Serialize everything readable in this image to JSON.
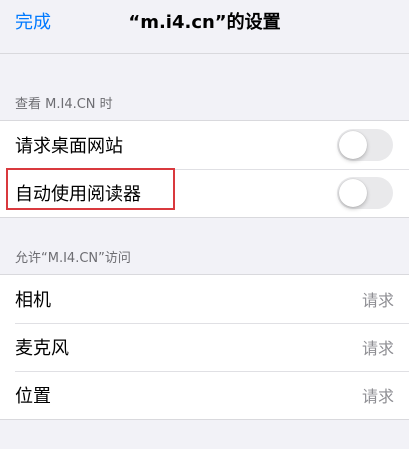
{
  "nav": {
    "done_label": "完成",
    "title": "“m.i4.cn”的设置"
  },
  "view_section": {
    "header": "查看 M.I4.CN 时",
    "rows": [
      {
        "label": "请求桌面网站",
        "toggle_on": false
      },
      {
        "label": "自动使用阅读器",
        "toggle_on": false
      }
    ]
  },
  "access_section": {
    "header": "允许“M.I4.CN”访问",
    "rows": [
      {
        "label": "相机",
        "value": "请求"
      },
      {
        "label": "麦克风",
        "value": "请求"
      },
      {
        "label": "位置",
        "value": "请求"
      }
    ]
  },
  "colors": {
    "accent": "#007aff",
    "highlight": "#d9393e",
    "background": "#f2f2f7"
  }
}
